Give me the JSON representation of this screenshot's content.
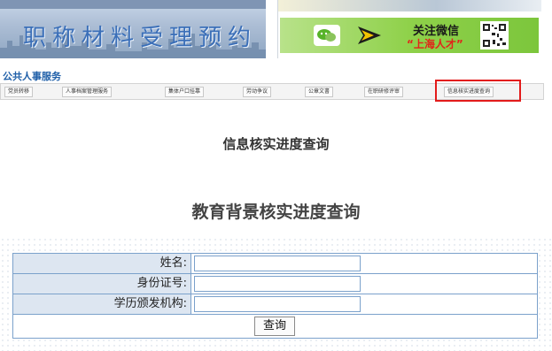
{
  "banner": {
    "title": "职称材料受理预约",
    "follow_line1": "关注微信",
    "follow_line2": "“上海人才”"
  },
  "section": {
    "title": "公共人事服务",
    "nav_items": [
      {
        "label": "党员转移"
      },
      {
        "label": "人事档案管理服务"
      },
      {
        "label": "集体户口挂靠"
      },
      {
        "label": "劳动争议"
      },
      {
        "label": "公章文書"
      },
      {
        "label": "在职研修评审"
      },
      {
        "label": "信息核实进度查询"
      }
    ],
    "highlighted_index": 6
  },
  "page": {
    "subtitle": "信息核实进度查询",
    "heading": "教育背景核实进度查询"
  },
  "form": {
    "fields": [
      {
        "label": "姓名:",
        "value": "",
        "placeholder": ""
      },
      {
        "label": "身份证号:",
        "value": "",
        "placeholder": ""
      },
      {
        "label": "学历颁发机构:",
        "value": "",
        "placeholder": ""
      }
    ],
    "submit_label": "查询"
  },
  "colors": {
    "accent_blue": "#1f5fa8",
    "table_border": "#7ba1cb",
    "label_bg": "#dde6f1",
    "highlight_red": "#e31b1b",
    "wechat_green": "#8fd14a"
  }
}
